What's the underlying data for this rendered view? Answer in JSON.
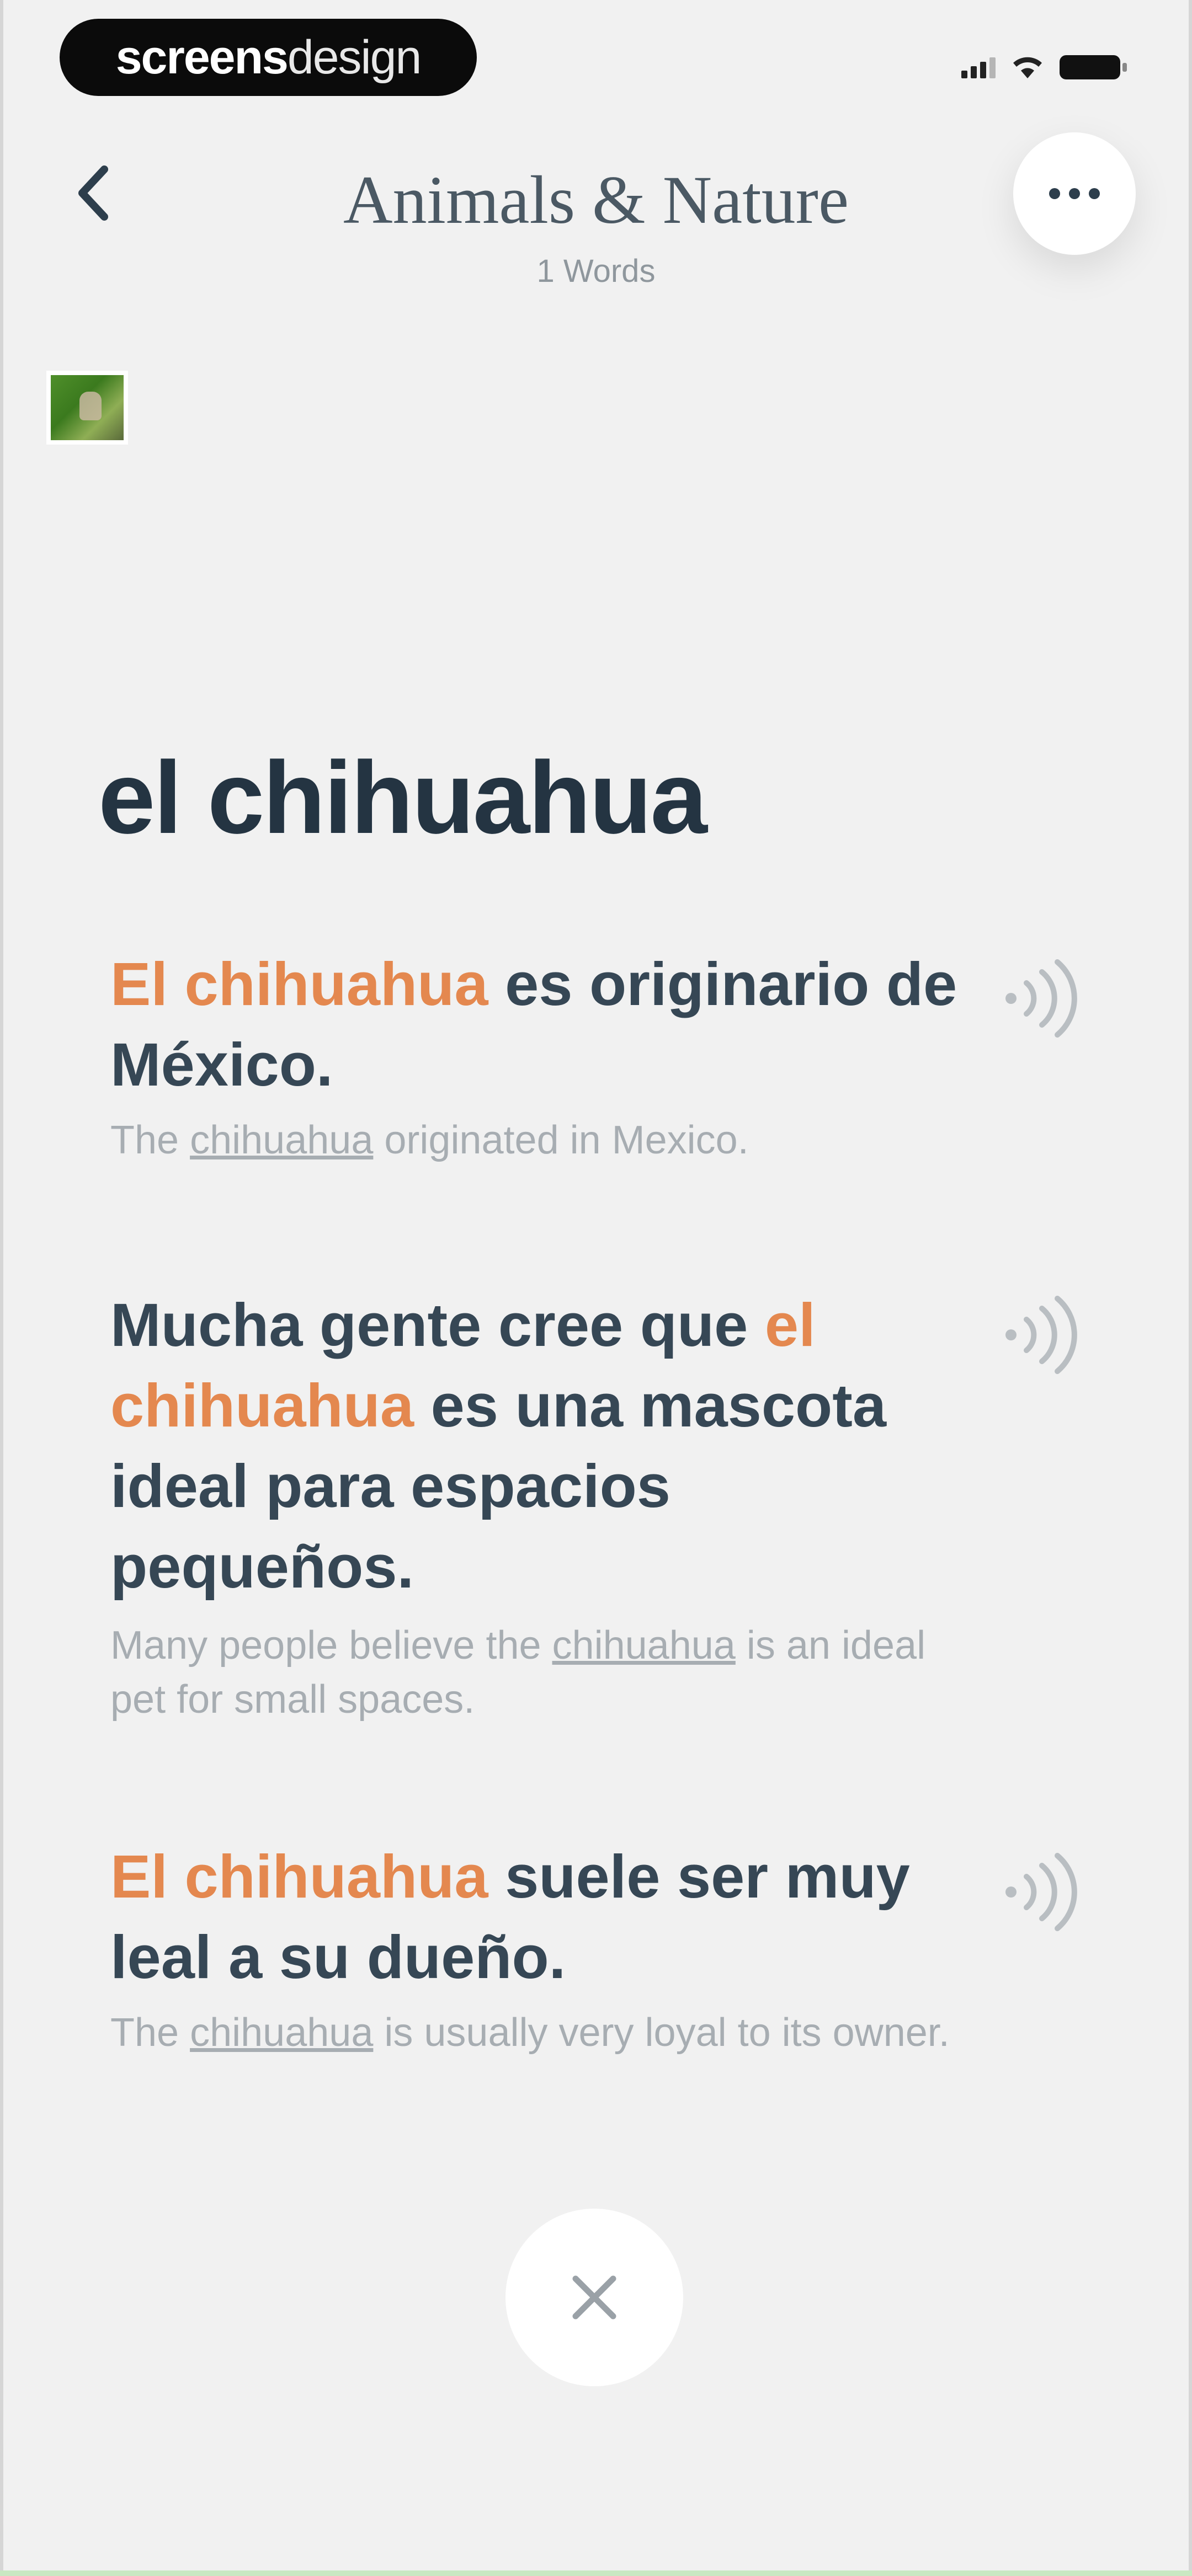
{
  "status_bar": {
    "brand_bold": "screens",
    "brand_light": "design"
  },
  "header": {
    "title": "Animals & Nature",
    "subtitle": "1 Words"
  },
  "word": {
    "text": "el chihuahua"
  },
  "examples": [
    {
      "es_highlight": "El chihuahua",
      "es_rest": " es originario de México.",
      "en_before": "The ",
      "en_word": "chihuahua",
      "en_after": " originated in Mexico."
    },
    {
      "es_before": "Mucha gente cree que ",
      "es_highlight": "el chihuahua",
      "es_rest": " es una mascota ideal para espacios pequeños.",
      "en_before": "Many people believe the ",
      "en_word": "chihuahua",
      "en_after": " is an ideal pet for small spaces."
    },
    {
      "es_highlight": "El chihuahua",
      "es_rest": " suele ser muy leal a su dueño.",
      "en_before": "The ",
      "en_word": "chihuahua",
      "en_after": " is usually very loyal to its owner."
    }
  ],
  "icons": {
    "back": "chevron-left-icon",
    "more": "more-dots-icon",
    "speaker": "speaker-icon",
    "close": "close-icon"
  },
  "colors": {
    "background": "#f1f1f1",
    "text_dark": "#2d3e4c",
    "highlight": "#e4884f",
    "muted": "#a7adb2"
  }
}
